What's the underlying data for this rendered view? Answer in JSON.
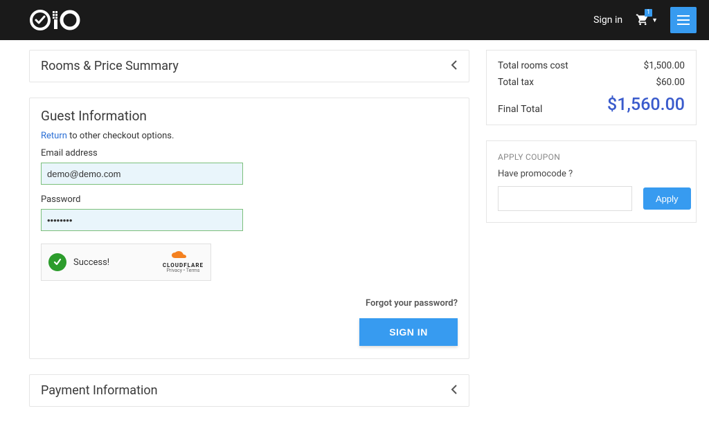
{
  "header": {
    "signin": "Sign in",
    "cart_count": "1"
  },
  "rooms_panel": {
    "title": "Rooms & Price Summary"
  },
  "guest": {
    "title": "Guest Information",
    "return_label": "Return",
    "return_rest": " to other checkout options.",
    "email_label": "Email address",
    "email_value": "demo@demo.com",
    "password_label": "Password",
    "password_value": "••••••••",
    "captcha_success": "Success!",
    "captcha_brand": "CLOUDFLARE",
    "captcha_pt": "Privacy • Terms",
    "forgot": "Forgot your password?",
    "signin_btn": "SIGN IN"
  },
  "payment_panel": {
    "title": "Payment Information"
  },
  "summary": {
    "rooms_label": "Total rooms cost",
    "rooms_value": "$1,500.00",
    "tax_label": "Total tax",
    "tax_value": "$60.00",
    "final_label": "Final Total",
    "final_value": "$1,560.00"
  },
  "coupon": {
    "title": "APPLY COUPON",
    "question": "Have promocode ?",
    "apply": "Apply"
  }
}
